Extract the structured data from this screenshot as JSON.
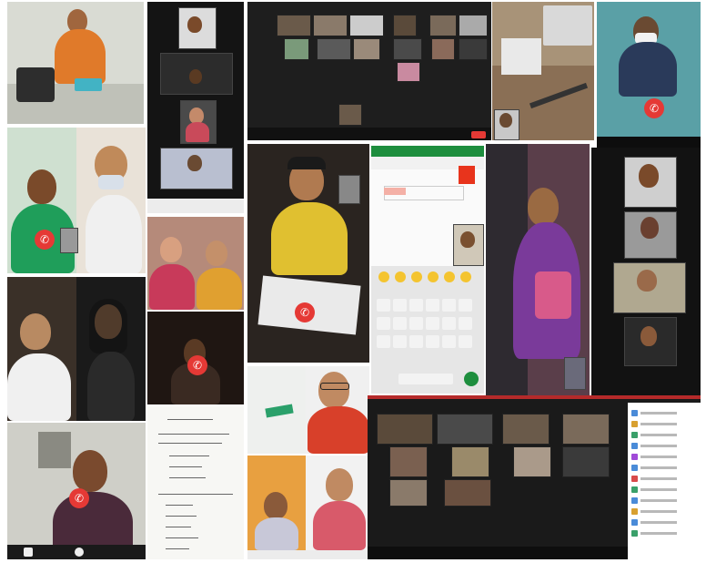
{
  "collage": {
    "tiles": [
      {
        "id": "woman-sewing",
        "kind": "photo"
      },
      {
        "id": "phone-grid-vertical-1",
        "kind": "video-call"
      },
      {
        "id": "zoom-gallery-top",
        "kind": "video-call"
      },
      {
        "id": "electronics-workbench",
        "kind": "photo"
      },
      {
        "id": "man-masked-phone",
        "kind": "video-call"
      },
      {
        "id": "two-person-call-1",
        "kind": "video-call"
      },
      {
        "id": "two-person-call-2",
        "kind": "video-call"
      },
      {
        "id": "boy-studying-call",
        "kind": "video-call"
      },
      {
        "id": "spreadsheet-keyboard",
        "kind": "app"
      },
      {
        "id": "girl-embroidery-call",
        "kind": "video-call"
      },
      {
        "id": "phone-grid-vertical-2",
        "kind": "video-call"
      },
      {
        "id": "child-call",
        "kind": "video-call"
      },
      {
        "id": "dim-room-call",
        "kind": "video-call"
      },
      {
        "id": "girl-glasses-call",
        "kind": "video-call"
      },
      {
        "id": "woman-call-bottom",
        "kind": "video-call"
      },
      {
        "id": "handwritten-notes",
        "kind": "document"
      },
      {
        "id": "two-person-call-3",
        "kind": "video-call"
      },
      {
        "id": "zoom-gallery-bottom",
        "kind": "video-call"
      }
    ],
    "colors": {
      "end_call_red": "#e53935",
      "call_bg": "#1c1c1c",
      "sheet_green": "#1e8e3e",
      "sheet_selected": "#e8341c"
    },
    "icons": [
      "end-call-icon",
      "camera-icon",
      "mic-icon",
      "emoji-icon"
    ]
  }
}
